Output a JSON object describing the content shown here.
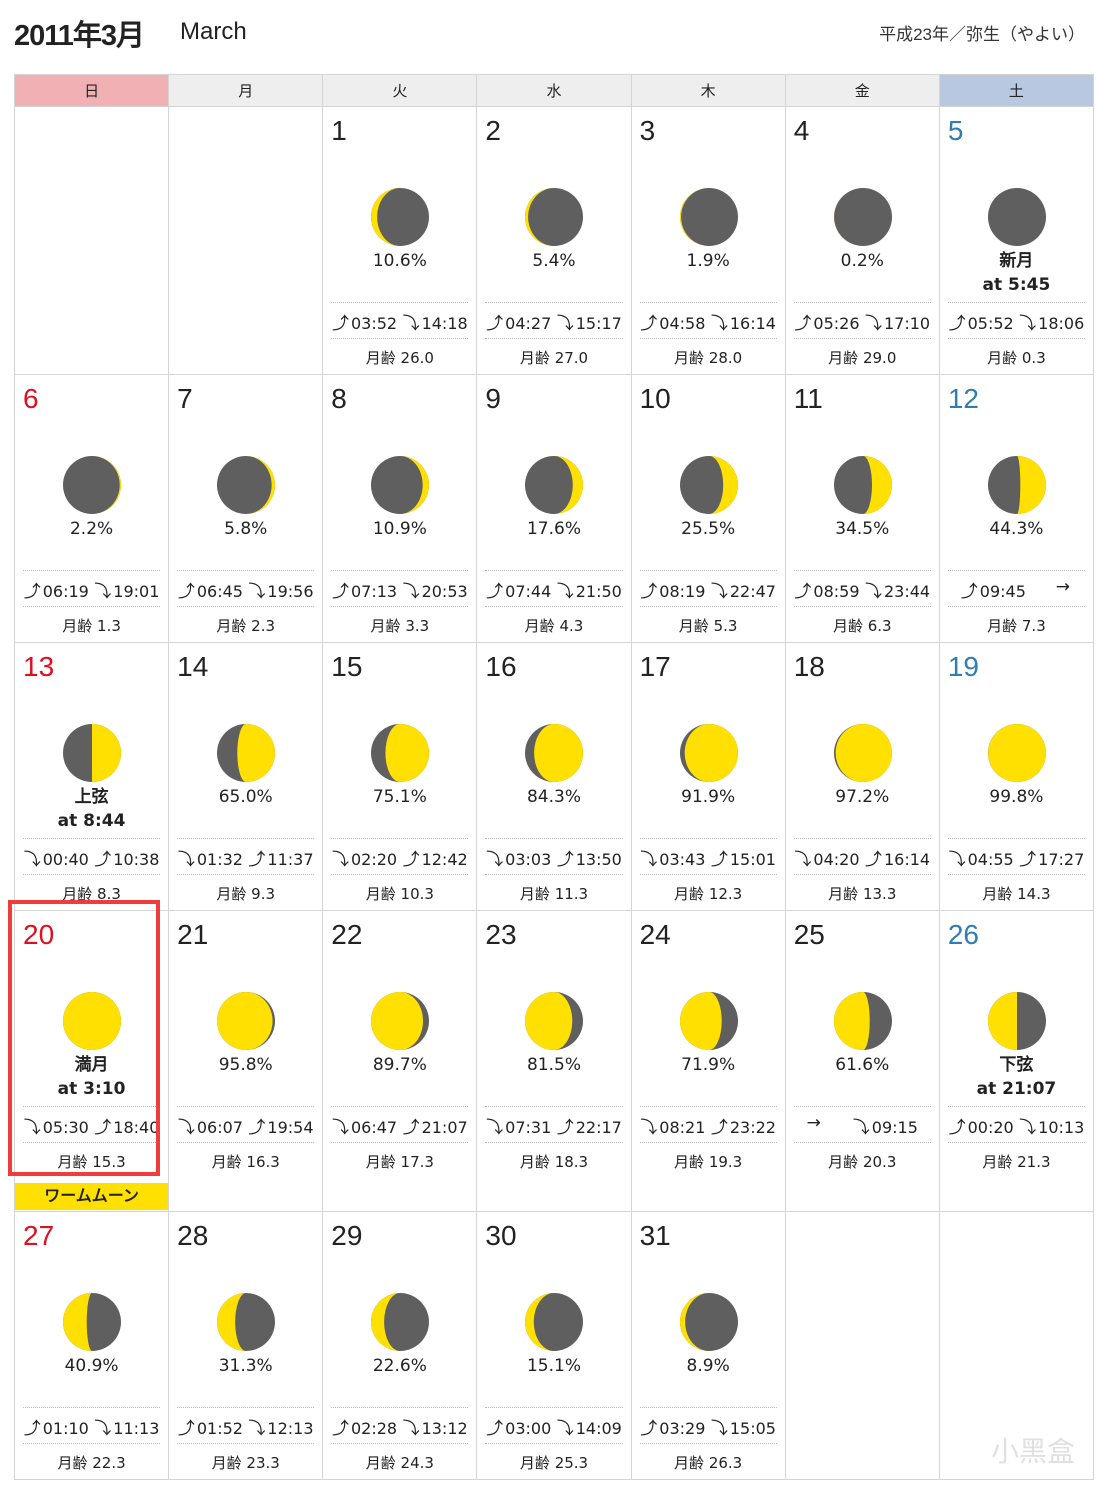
{
  "header": {
    "title": "2011年3月",
    "title_en": "March",
    "era": "平成23年／弥生（やよい）"
  },
  "weekdays": [
    "日",
    "月",
    "火",
    "水",
    "木",
    "金",
    "土"
  ],
  "colors": {
    "lit": "#ffe000",
    "dark": "#5f5f5f",
    "sunday": "#dc1020",
    "saturday": "#2f7db3",
    "highlight": "#f03c3c"
  },
  "age_label": "月齢",
  "weeks": [
    [
      null,
      null,
      {
        "day": "1",
        "pct": "10.6%",
        "illum": 10.6,
        "waxing": false,
        "events": [
          {
            "type": "rise",
            "time": "03:52"
          },
          {
            "type": "set",
            "time": "14:18"
          }
        ],
        "age": "26.0"
      },
      {
        "day": "2",
        "pct": "5.4%",
        "illum": 5.4,
        "waxing": false,
        "events": [
          {
            "type": "rise",
            "time": "04:27"
          },
          {
            "type": "set",
            "time": "15:17"
          }
        ],
        "age": "27.0"
      },
      {
        "day": "3",
        "pct": "1.9%",
        "illum": 1.9,
        "waxing": false,
        "events": [
          {
            "type": "rise",
            "time": "04:58"
          },
          {
            "type": "set",
            "time": "16:14"
          }
        ],
        "age": "28.0"
      },
      {
        "day": "4",
        "pct": "0.2%",
        "illum": 0.2,
        "waxing": false,
        "events": [
          {
            "type": "rise",
            "time": "05:26"
          },
          {
            "type": "set",
            "time": "17:10"
          }
        ],
        "age": "29.0"
      },
      {
        "day": "5",
        "phase": "新月",
        "phase_time": "at 5:45",
        "illum": 0,
        "waxing": true,
        "events": [
          {
            "type": "rise",
            "time": "05:52"
          },
          {
            "type": "set",
            "time": "18:06"
          }
        ],
        "age": "0.3"
      }
    ],
    [
      {
        "day": "6",
        "pct": "2.2%",
        "illum": 2.2,
        "waxing": true,
        "events": [
          {
            "type": "rise",
            "time": "06:19"
          },
          {
            "type": "set",
            "time": "19:01"
          }
        ],
        "age": "1.3"
      },
      {
        "day": "7",
        "pct": "5.8%",
        "illum": 5.8,
        "waxing": true,
        "events": [
          {
            "type": "rise",
            "time": "06:45"
          },
          {
            "type": "set",
            "time": "19:56"
          }
        ],
        "age": "2.3"
      },
      {
        "day": "8",
        "pct": "10.9%",
        "illum": 10.9,
        "waxing": true,
        "events": [
          {
            "type": "rise",
            "time": "07:13"
          },
          {
            "type": "set",
            "time": "20:53"
          }
        ],
        "age": "3.3"
      },
      {
        "day": "9",
        "pct": "17.6%",
        "illum": 17.6,
        "waxing": true,
        "events": [
          {
            "type": "rise",
            "time": "07:44"
          },
          {
            "type": "set",
            "time": "21:50"
          }
        ],
        "age": "4.3"
      },
      {
        "day": "10",
        "pct": "25.5%",
        "illum": 25.5,
        "waxing": true,
        "events": [
          {
            "type": "rise",
            "time": "08:19"
          },
          {
            "type": "set",
            "time": "22:47"
          }
        ],
        "age": "5.3"
      },
      {
        "day": "11",
        "pct": "34.5%",
        "illum": 34.5,
        "waxing": true,
        "events": [
          {
            "type": "rise",
            "time": "08:59"
          },
          {
            "type": "set",
            "time": "23:44"
          }
        ],
        "age": "6.3"
      },
      {
        "day": "12",
        "pct": "44.3%",
        "illum": 44.3,
        "waxing": true,
        "events": [
          {
            "type": "rise",
            "time": "09:45"
          },
          {
            "type": "none",
            "time": ""
          }
        ],
        "age": "7.3"
      }
    ],
    [
      {
        "day": "13",
        "phase": "上弦",
        "phase_time": "at 8:44",
        "illum": 50,
        "waxing": true,
        "events": [
          {
            "type": "set",
            "time": "00:40"
          },
          {
            "type": "rise",
            "time": "10:38"
          }
        ],
        "age": "8.3"
      },
      {
        "day": "14",
        "pct": "65.0%",
        "illum": 65.0,
        "waxing": true,
        "events": [
          {
            "type": "set",
            "time": "01:32"
          },
          {
            "type": "rise",
            "time": "11:37"
          }
        ],
        "age": "9.3"
      },
      {
        "day": "15",
        "pct": "75.1%",
        "illum": 75.1,
        "waxing": true,
        "events": [
          {
            "type": "set",
            "time": "02:20"
          },
          {
            "type": "rise",
            "time": "12:42"
          }
        ],
        "age": "10.3"
      },
      {
        "day": "16",
        "pct": "84.3%",
        "illum": 84.3,
        "waxing": true,
        "events": [
          {
            "type": "set",
            "time": "03:03"
          },
          {
            "type": "rise",
            "time": "13:50"
          }
        ],
        "age": "11.3"
      },
      {
        "day": "17",
        "pct": "91.9%",
        "illum": 91.9,
        "waxing": true,
        "events": [
          {
            "type": "set",
            "time": "03:43"
          },
          {
            "type": "rise",
            "time": "15:01"
          }
        ],
        "age": "12.3"
      },
      {
        "day": "18",
        "pct": "97.2%",
        "illum": 97.2,
        "waxing": true,
        "events": [
          {
            "type": "set",
            "time": "04:20"
          },
          {
            "type": "rise",
            "time": "16:14"
          }
        ],
        "age": "13.3"
      },
      {
        "day": "19",
        "pct": "99.8%",
        "illum": 99.8,
        "waxing": true,
        "events": [
          {
            "type": "set",
            "time": "04:55"
          },
          {
            "type": "rise",
            "time": "17:27"
          }
        ],
        "age": "14.3"
      }
    ],
    [
      {
        "day": "20",
        "phase": "満月",
        "phase_time": "at 3:10",
        "illum": 100,
        "waxing": true,
        "events": [
          {
            "type": "set",
            "time": "05:30"
          },
          {
            "type": "rise",
            "time": "18:40"
          }
        ],
        "age": "15.3",
        "highlight": true,
        "banner": "ワームムーン"
      },
      {
        "day": "21",
        "pct": "95.8%",
        "illum": 95.8,
        "waxing": false,
        "events": [
          {
            "type": "set",
            "time": "06:07"
          },
          {
            "type": "rise",
            "time": "19:54"
          }
        ],
        "age": "16.3"
      },
      {
        "day": "22",
        "pct": "89.7%",
        "illum": 89.7,
        "waxing": false,
        "events": [
          {
            "type": "set",
            "time": "06:47"
          },
          {
            "type": "rise",
            "time": "21:07"
          }
        ],
        "age": "17.3"
      },
      {
        "day": "23",
        "pct": "81.5%",
        "illum": 81.5,
        "waxing": false,
        "events": [
          {
            "type": "set",
            "time": "07:31"
          },
          {
            "type": "rise",
            "time": "22:17"
          }
        ],
        "age": "18.3"
      },
      {
        "day": "24",
        "pct": "71.9%",
        "illum": 71.9,
        "waxing": false,
        "events": [
          {
            "type": "set",
            "time": "08:21"
          },
          {
            "type": "rise",
            "time": "23:22"
          }
        ],
        "age": "19.3"
      },
      {
        "day": "25",
        "pct": "61.6%",
        "illum": 61.6,
        "waxing": false,
        "events": [
          {
            "type": "none",
            "time": ""
          },
          {
            "type": "set",
            "time": "09:15"
          }
        ],
        "age": "20.3"
      },
      {
        "day": "26",
        "phase": "下弦",
        "phase_time": "at 21:07",
        "illum": 50,
        "waxing": false,
        "events": [
          {
            "type": "rise",
            "time": "00:20"
          },
          {
            "type": "set",
            "time": "10:13"
          }
        ],
        "age": "21.3"
      }
    ],
    [
      {
        "day": "27",
        "pct": "40.9%",
        "illum": 40.9,
        "waxing": false,
        "events": [
          {
            "type": "rise",
            "time": "01:10"
          },
          {
            "type": "set",
            "time": "11:13"
          }
        ],
        "age": "22.3"
      },
      {
        "day": "28",
        "pct": "31.3%",
        "illum": 31.3,
        "waxing": false,
        "events": [
          {
            "type": "rise",
            "time": "01:52"
          },
          {
            "type": "set",
            "time": "12:13"
          }
        ],
        "age": "23.3"
      },
      {
        "day": "29",
        "pct": "22.6%",
        "illum": 22.6,
        "waxing": false,
        "events": [
          {
            "type": "rise",
            "time": "02:28"
          },
          {
            "type": "set",
            "time": "13:12"
          }
        ],
        "age": "24.3"
      },
      {
        "day": "30",
        "pct": "15.1%",
        "illum": 15.1,
        "waxing": false,
        "events": [
          {
            "type": "rise",
            "time": "03:00"
          },
          {
            "type": "set",
            "time": "14:09"
          }
        ],
        "age": "25.3"
      },
      {
        "day": "31",
        "pct": "8.9%",
        "illum": 8.9,
        "waxing": false,
        "events": [
          {
            "type": "rise",
            "time": "03:29"
          },
          {
            "type": "set",
            "time": "15:05"
          }
        ],
        "age": "26.3"
      },
      null,
      null
    ]
  ],
  "watermark": "小黑盒"
}
